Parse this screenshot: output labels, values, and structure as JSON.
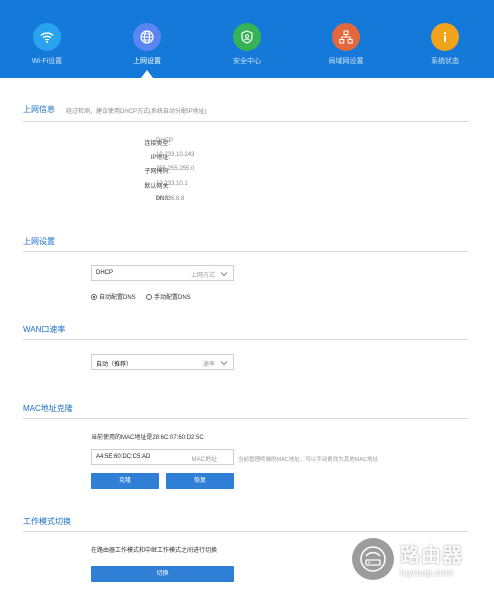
{
  "nav": {
    "items": [
      {
        "label": "Wi-Fi设置",
        "icon": "wifi-icon",
        "color": "#29a3ee"
      },
      {
        "label": "上网设置",
        "icon": "globe-icon",
        "color": "#5b86f2"
      },
      {
        "label": "安全中心",
        "icon": "shield-icon",
        "color": "#35b356"
      },
      {
        "label": "局域网设置",
        "icon": "network-icon",
        "color": "#e3683d"
      },
      {
        "label": "系统状态",
        "icon": "info-icon",
        "color": "#f2a31c"
      }
    ],
    "active_index": 1,
    "bg_color": "#1479d8"
  },
  "internet_info": {
    "title": "上网信息",
    "desc": "经过检测，建议使用DHCP方式(系统自动分配IP地址)",
    "rows": [
      {
        "label": "连接类型:",
        "value": "DHCP"
      },
      {
        "label": "IP地址:",
        "value": "10.233.10.243"
      },
      {
        "label": "子网掩码:",
        "value": "255.255.255.0"
      },
      {
        "label": "默认网关:",
        "value": "10.233.10.1"
      },
      {
        "label": "DNS:",
        "value": "10.236.8.8"
      }
    ]
  },
  "internet_settings": {
    "title": "上网设置",
    "select_value": "DHCP",
    "select_hint": "上网方式",
    "radio_auto": "自动配置DNS",
    "radio_manual": "手动配置DNS"
  },
  "wan_speed": {
    "title": "WAN口速率",
    "select_value": "自动（推荐）",
    "select_hint": "速率"
  },
  "mac_clone": {
    "title": "MAC地址克隆",
    "current_text": "当前使用的MAC地址是28:6C:07:60:D2:5C",
    "input_value": "A4:5E:60:DC:C5:AD",
    "input_hint": "MAC地址",
    "tip": "当前管理终端的MAC地址，可以手动更改为其他MAC地址",
    "clone_button": "克隆",
    "restore_button": "恢复"
  },
  "work_mode": {
    "title": "工作模式切换",
    "desc": "在路由器工作模式和中继工作模式之间进行切换",
    "switch_button": "切换"
  },
  "watermark": {
    "title": "路由器",
    "url": "luyouqi.com"
  }
}
